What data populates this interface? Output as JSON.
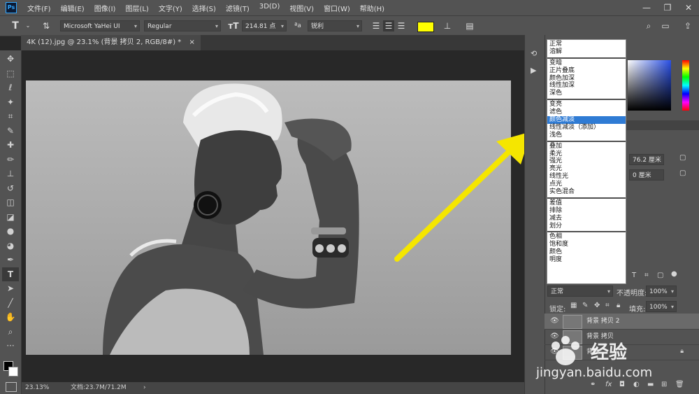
{
  "app": {
    "logo": "Ps"
  },
  "menu": [
    "文件(F)",
    "编辑(E)",
    "图像(I)",
    "图层(L)",
    "文字(Y)",
    "选择(S)",
    "滤镜(T)",
    "3D(D)",
    "视图(V)",
    "窗口(W)",
    "帮助(H)"
  ],
  "window_controls": {
    "minimize": "—",
    "restore": "❐",
    "close": "✕"
  },
  "options": {
    "font_family": "Microsoft YaHei UI",
    "font_style": "Regular",
    "font_size": "214.81 点",
    "aa_label": "ªa",
    "antialias": "锐利",
    "text_color": "#ffff00"
  },
  "tools": [
    {
      "name": "move-tool",
      "icon": "✥"
    },
    {
      "name": "marquee-tool",
      "icon": "⬚"
    },
    {
      "name": "lasso-tool",
      "icon": "ℓ"
    },
    {
      "name": "magic-wand-tool",
      "icon": "✦"
    },
    {
      "name": "crop-tool",
      "icon": "⌗"
    },
    {
      "name": "eyedropper-tool",
      "icon": "✎"
    },
    {
      "name": "healing-tool",
      "icon": "✚"
    },
    {
      "name": "brush-tool",
      "icon": "✏"
    },
    {
      "name": "stamp-tool",
      "icon": "⊥"
    },
    {
      "name": "history-brush-tool",
      "icon": "↺"
    },
    {
      "name": "eraser-tool",
      "icon": "◫"
    },
    {
      "name": "paint-bucket-tool",
      "icon": "◪"
    },
    {
      "name": "blur-tool",
      "icon": "●"
    },
    {
      "name": "dodge-tool",
      "icon": "◕"
    },
    {
      "name": "pen-tool",
      "icon": "✒"
    },
    {
      "name": "type-tool",
      "icon": "T"
    },
    {
      "name": "path-select-tool",
      "icon": "➤"
    },
    {
      "name": "line-tool",
      "icon": "╱"
    },
    {
      "name": "hand-tool",
      "icon": "✋"
    },
    {
      "name": "zoom-tool",
      "icon": "⌕"
    },
    {
      "name": "more-tools",
      "icon": "···"
    }
  ],
  "document": {
    "tab_title": "4K (12).jpg @ 23.1% (背景 拷贝 2, RGB/8#) *",
    "tab_close": "×"
  },
  "status": {
    "zoom": "23.13%",
    "doc": "文档:23.7M/71.2M",
    "arrow": "›"
  },
  "blend_modes": [
    [
      "正常",
      "溶解"
    ],
    [
      "变暗",
      "正片叠底",
      "颜色加深",
      "线性加深",
      "深色"
    ],
    [
      "变亮",
      "滤色",
      "颜色减淡",
      "线性减淡（添加）",
      "浅色"
    ],
    [
      "叠加",
      "柔光",
      "强光",
      "亮光",
      "线性光",
      "点光",
      "实色混合"
    ],
    [
      "差值",
      "排除",
      "减去",
      "划分"
    ],
    [
      "色相",
      "饱和度",
      "颜色",
      "明度"
    ]
  ],
  "blend_selected": "颜色减淡",
  "properties": {
    "width": "76.2 厘米",
    "height": "0 厘米"
  },
  "layers_panel": {
    "blend_current": "正常",
    "opacity_label": "不透明度:",
    "opacity_value": "100%",
    "lock_label": "锁定:",
    "fill_label": "填充:",
    "fill_value": "100%",
    "layers": [
      {
        "name": "背景 拷贝 2"
      },
      {
        "name": "背景 拷贝"
      },
      {
        "name": "背景"
      }
    ]
  },
  "watermark": {
    "brand": "经验",
    "url": "jingyan.baidu.com"
  },
  "colors": {
    "arrow": "#f5e600",
    "selection": "#2f7bd4"
  }
}
